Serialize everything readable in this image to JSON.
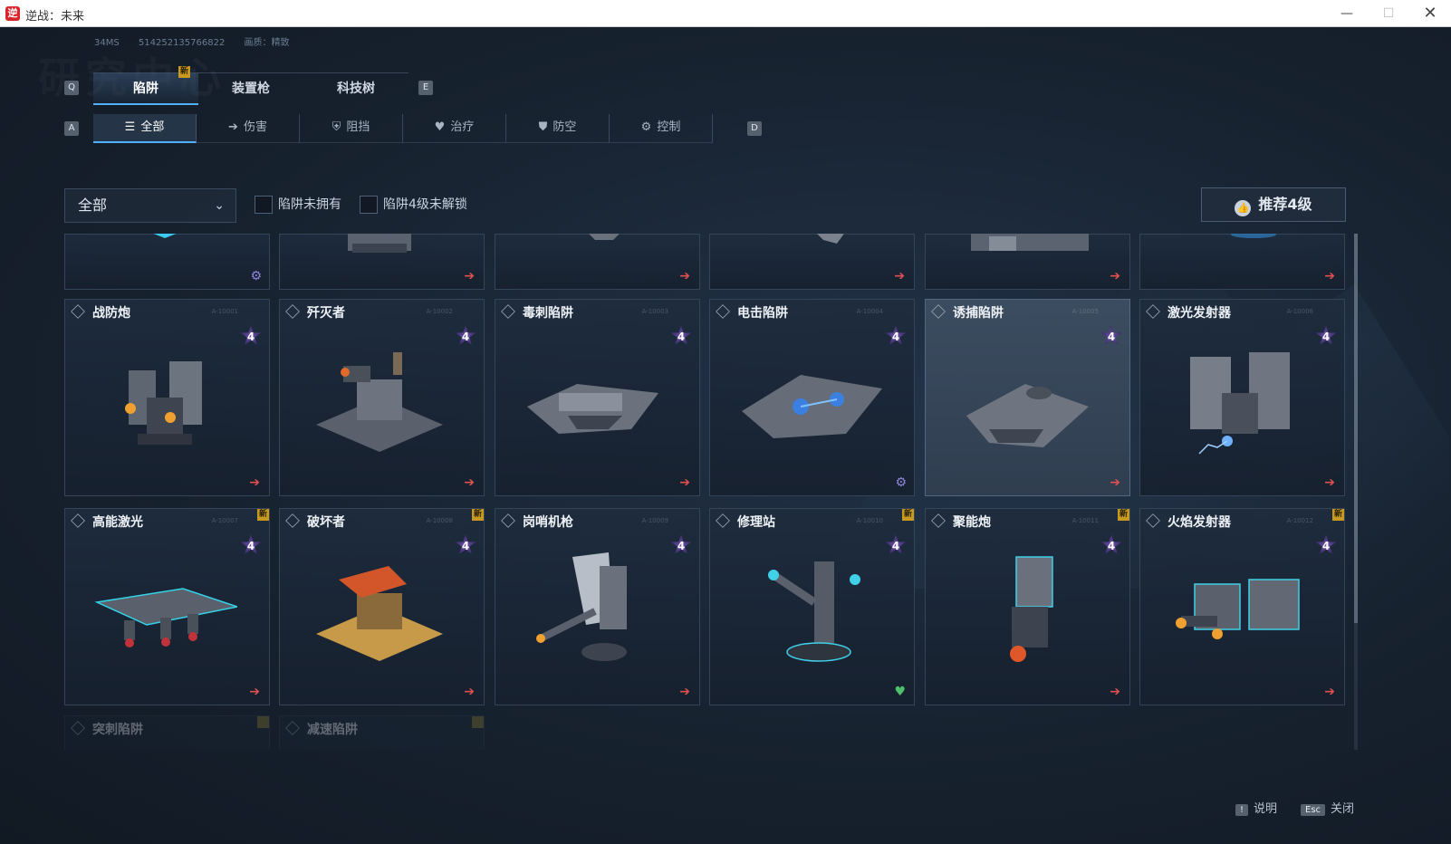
{
  "window": {
    "title": "逆战：未来"
  },
  "debug": {
    "ping": "34MS",
    "id": "514252135766822",
    "quality": "画质：精致"
  },
  "watermark": "研究中心",
  "main_tabs": [
    {
      "key": "Q"
    },
    {
      "label": "陷阱",
      "new_badge": "新"
    },
    {
      "label": "装置枪"
    },
    {
      "label": "科技树"
    },
    {
      "key": "E"
    }
  ],
  "main_tabs_keys": {
    "left": "Q",
    "right": "E"
  },
  "sub_tabs": [
    {
      "label": "全部",
      "icon": "list-icon"
    },
    {
      "label": "伤害",
      "icon": "arrow-icon"
    },
    {
      "label": "阻挡",
      "icon": "shield-icon"
    },
    {
      "label": "治疗",
      "icon": "heart-icon"
    },
    {
      "label": "防空",
      "icon": "antiair-icon"
    },
    {
      "label": "控制",
      "icon": "gear-icon"
    }
  ],
  "sub_tabs_keys": {
    "left": "A",
    "right": "D"
  },
  "filter": {
    "dropdown_value": "全部",
    "check1": "陷阱未拥有",
    "check2": "陷阱4级未解锁",
    "recommend": "推荐4级"
  },
  "cards_row2": [
    {
      "name": "战防炮",
      "level": "4",
      "corner": "arrow"
    },
    {
      "name": "歼灭者",
      "level": "4",
      "corner": "arrow"
    },
    {
      "name": "毒刺陷阱",
      "level": "4",
      "corner": "arrow"
    },
    {
      "name": "电击陷阱",
      "level": "4",
      "corner": "gear"
    },
    {
      "name": "诱捕陷阱",
      "level": "4",
      "corner": "arrow"
    },
    {
      "name": "激光发射器",
      "level": "4",
      "corner": "arrow"
    }
  ],
  "cards_row3": [
    {
      "name": "高能激光",
      "level": "4",
      "corner": "arrow",
      "new": "新"
    },
    {
      "name": "破坏者",
      "level": "4",
      "corner": "arrow",
      "new": "新"
    },
    {
      "name": "岗哨机枪",
      "level": "4",
      "corner": "arrow"
    },
    {
      "name": "修理站",
      "level": "4",
      "corner": "heart",
      "new": "新"
    },
    {
      "name": "聚能炮",
      "level": "4",
      "corner": "arrow",
      "new": "新"
    },
    {
      "name": "火焰发射器",
      "level": "4",
      "corner": "arrow",
      "new": "新"
    }
  ],
  "cards_row4": [
    {
      "name": "突刺陷阱"
    },
    {
      "name": "减速陷阱"
    }
  ],
  "footer": {
    "help_key": "!",
    "help_label": "说明",
    "close_key": "Esc",
    "close_label": "关闭"
  },
  "colors": {
    "accent": "#4fb2ff",
    "new_badge": "#c79a1f",
    "arrow": "#e05050",
    "level_star": "#6a4fa8"
  }
}
